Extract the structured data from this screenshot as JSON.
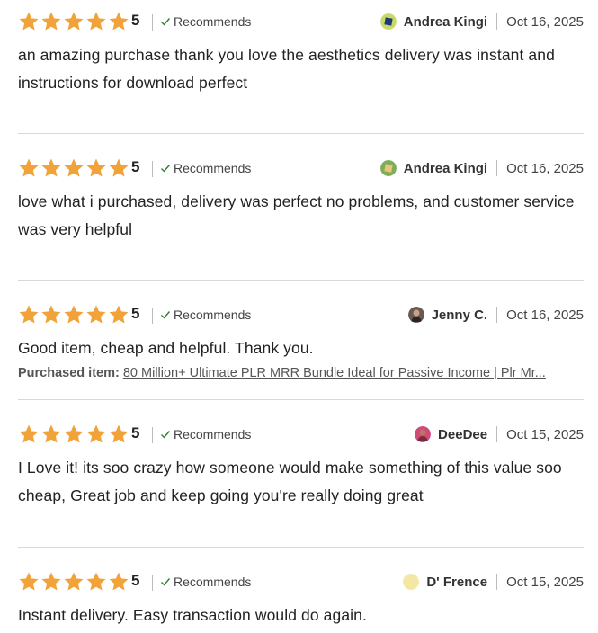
{
  "colors": {
    "star": "#f1a33a",
    "check": "#2e7d32"
  },
  "reviews": [
    {
      "rating": "5",
      "recommends_label": "Recommends",
      "author": "Andrea Kingi",
      "date": "Oct 16, 2025",
      "text": "an amazing purchase thank you love the aesthetics delivery was instant and instructions for download perfect",
      "avatar": "user-avatar-icon"
    },
    {
      "rating": "5",
      "recommends_label": "Recommends",
      "author": "Andrea Kingi",
      "date": "Oct 16, 2025",
      "text": "love what i purchased, delivery was perfect no problems, and customer service was very helpful",
      "avatar": "user-avatar-icon"
    },
    {
      "rating": "5",
      "recommends_label": "Recommends",
      "author": "Jenny C.",
      "date": "Oct 16, 2025",
      "text": "Good item, cheap and helpful. Thank you.",
      "purchased_label": "Purchased item:",
      "purchased_item": "80 Million+ Ultimate PLR MRR Bundle Ideal for Passive Income | Plr Mr...",
      "avatar": "user-avatar-photo"
    },
    {
      "rating": "5",
      "recommends_label": "Recommends",
      "author": "DeeDee",
      "date": "Oct 15, 2025",
      "text": "I Love it! its soo crazy how someone would make something of this value soo cheap, Great job and keep going you're really doing great",
      "avatar": "user-avatar-photo"
    },
    {
      "rating": "5",
      "recommends_label": "Recommends",
      "author": "D' Frence",
      "date": "Oct 15, 2025",
      "text": "Instant delivery. Easy transaction would do again.",
      "avatar": "user-avatar-icon"
    }
  ]
}
